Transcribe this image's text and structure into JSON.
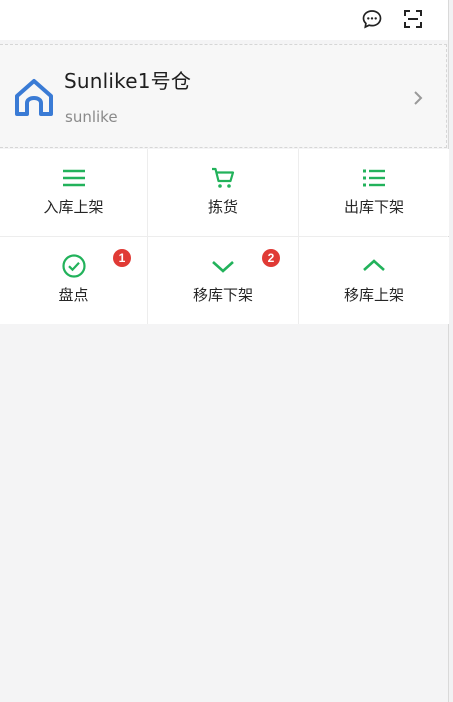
{
  "header": {
    "message_icon": "message-icon",
    "scan_icon": "scan-icon"
  },
  "warehouse": {
    "name": "Sunlike1号仓",
    "code": "sunlike",
    "icon": "home-icon",
    "icon_color": "#3a7bd5"
  },
  "menu": {
    "items": [
      {
        "label": "入库上架",
        "icon": "list-icon"
      },
      {
        "label": "拣货",
        "icon": "cart-icon"
      },
      {
        "label": "出库下架",
        "icon": "bulleted-list-icon"
      },
      {
        "label": "盘点",
        "icon": "check-circle-icon",
        "badge": "1"
      },
      {
        "label": "移库下架",
        "icon": "chevron-down-icon",
        "badge": "2"
      },
      {
        "label": "移库上架",
        "icon": "chevron-up-icon"
      }
    ]
  },
  "colors": {
    "accent": "#22b25b",
    "badge": "#e03a35"
  }
}
